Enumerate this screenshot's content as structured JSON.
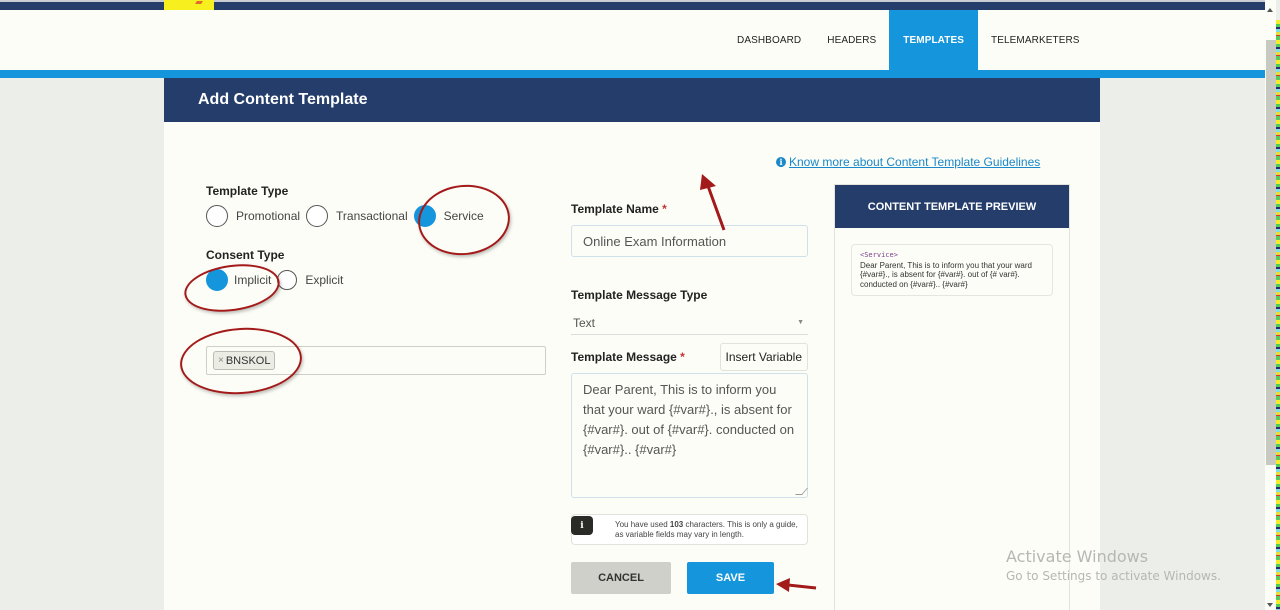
{
  "nav": {
    "items": [
      {
        "label": "DASHBOARD",
        "active": false
      },
      {
        "label": "HEADERS",
        "active": false
      },
      {
        "label": "TEMPLATES",
        "active": true
      },
      {
        "label": "TELEMARKETERS",
        "active": false
      }
    ]
  },
  "page": {
    "title": "Add Content Template",
    "guidelines_link": "Know more about Content Template Guidelines"
  },
  "form": {
    "template_type": {
      "label": "Template Type",
      "options": [
        "Promotional",
        "Transactional",
        "Service"
      ],
      "selected": "Service"
    },
    "consent_type": {
      "label": "Consent Type",
      "options": [
        "Implicit",
        "Explicit"
      ],
      "selected": "Implicit"
    },
    "headers": {
      "tags": [
        "BNSKOL"
      ],
      "remove_glyph": "×"
    },
    "template_name": {
      "label": "Template Name",
      "required_mark": "*",
      "value": "Online Exam Information"
    },
    "message_type": {
      "label": "Template Message Type",
      "value": "Text"
    },
    "message": {
      "label": "Template Message",
      "required_mark": "*",
      "insert_variable_label": "Insert Variable",
      "value": "Dear Parent, This is to inform you that your ward {#var#}., is absent for {#var#}. out of {#var#}. conducted on {#var#}.. {#var#}"
    },
    "char_note": {
      "prefix": "You have used ",
      "count": "103",
      "suffix": " characters. This is only a guide, as variable fields may vary in length."
    },
    "buttons": {
      "cancel": "CANCEL",
      "save": "SAVE"
    }
  },
  "preview": {
    "title": "CONTENT TEMPLATE PREVIEW",
    "type_tag": "<Service>",
    "body": "Dear Parent, This is to inform you that your ward {#var#}., is absent for {#var#}. out of {# var#}. conducted on {#var#}.. {#var#}"
  },
  "watermark": {
    "line1": "Activate Windows",
    "line2": "Go to Settings to activate Windows."
  },
  "colors": {
    "navy": "#243d6b",
    "accent_blue": "#1595dc",
    "annotation_red": "#a31a1a"
  }
}
